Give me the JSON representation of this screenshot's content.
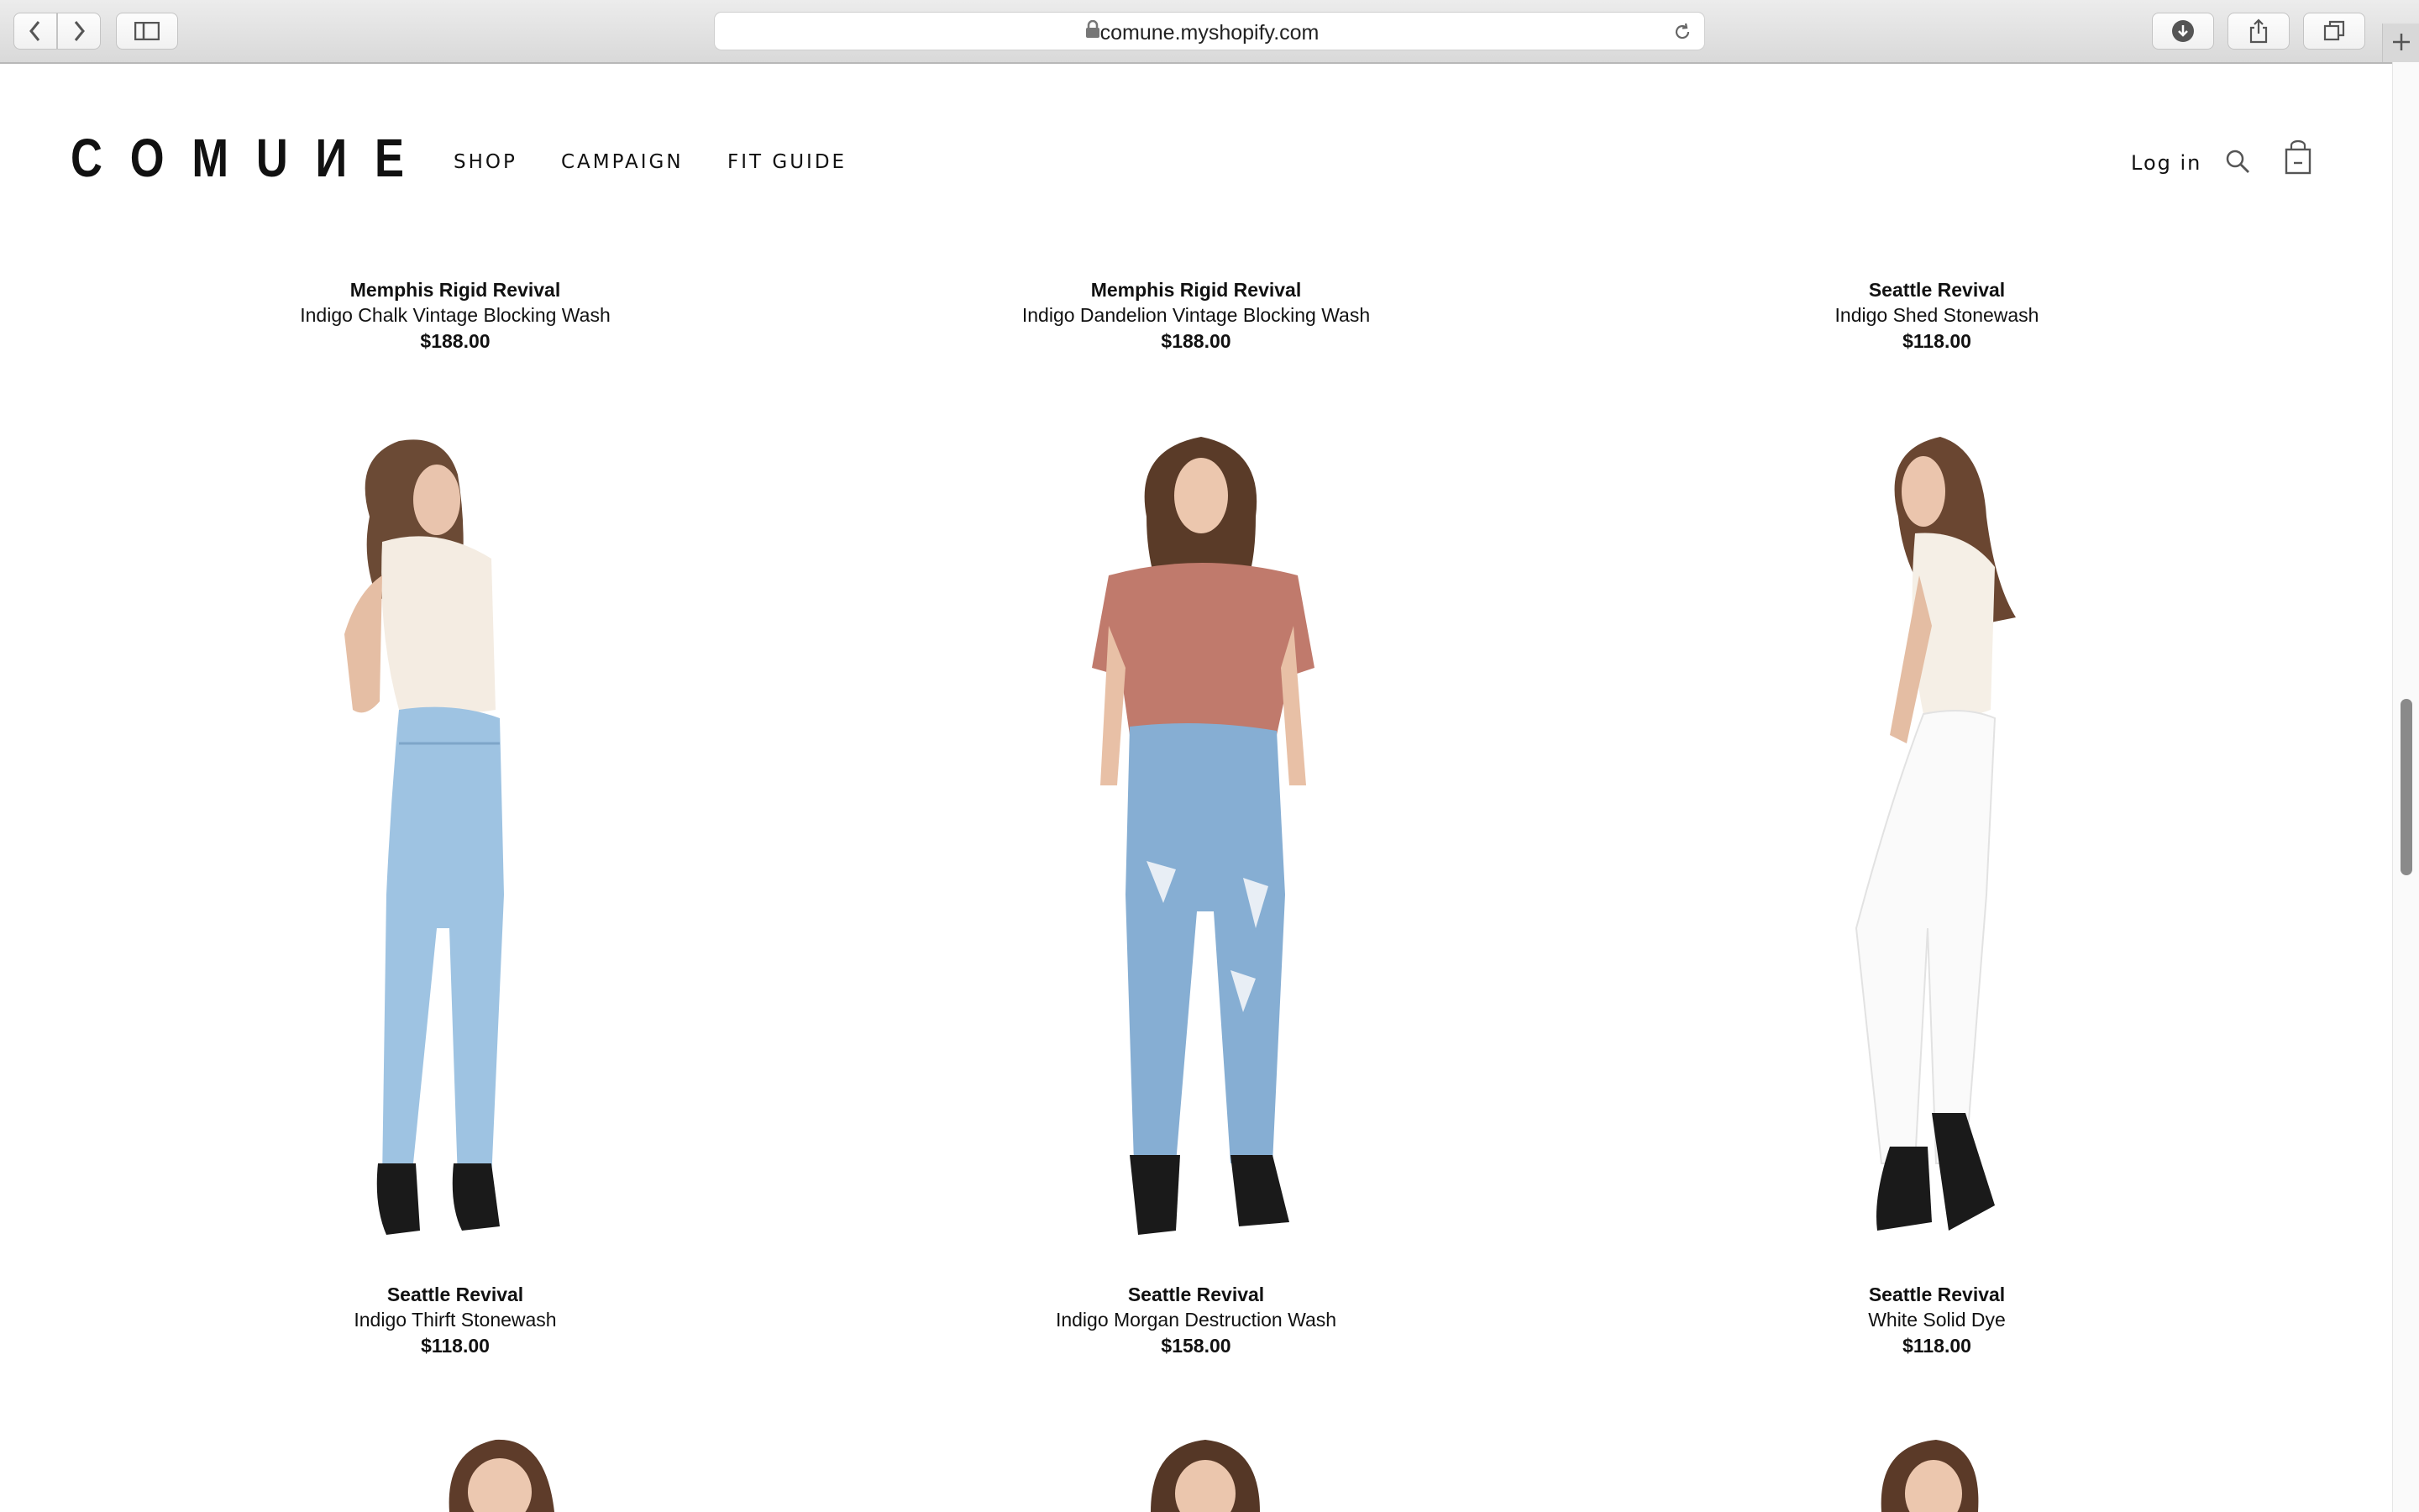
{
  "browser": {
    "url": "comune.myshopify.com"
  },
  "header": {
    "logo": "COMUИE",
    "nav": [
      "SHOP",
      "CAMPAIGN",
      "FIT GUIDE"
    ],
    "login": "Log in"
  },
  "products_top": [
    {
      "name": "Memphis Rigid Revival",
      "desc": "Indigo Chalk Vintage Blocking Wash",
      "price": "$188.00"
    },
    {
      "name": "Memphis Rigid Revival",
      "desc": "Indigo Dandelion Vintage Blocking Wash",
      "price": "$188.00"
    },
    {
      "name": "Seattle Revival",
      "desc": "Indigo Shed Stonewash",
      "price": "$118.00"
    }
  ],
  "products": [
    {
      "name": "Seattle Revival",
      "desc": "Indigo Thirft Stonewash",
      "price": "$118.00"
    },
    {
      "name": "Seattle Revival",
      "desc": "Indigo Morgan Destruction Wash",
      "price": "$158.00"
    },
    {
      "name": "Seattle Revival",
      "desc": "White Solid Dye",
      "price": "$118.00"
    }
  ],
  "scroll_position": 0.44
}
